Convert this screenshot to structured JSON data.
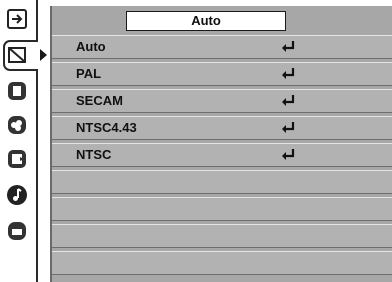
{
  "menu": {
    "current_value": "Auto",
    "items": [
      {
        "label": "Auto"
      },
      {
        "label": "PAL"
      },
      {
        "label": "SECAM"
      },
      {
        "label": "NTSC4.43"
      },
      {
        "label": "NTSC"
      },
      {
        "label": ""
      },
      {
        "label": ""
      },
      {
        "label": ""
      },
      {
        "label": ""
      }
    ]
  },
  "sidebar": {
    "icons": [
      "input-icon",
      "system-icon",
      "image-icon",
      "color-icon",
      "screen-icon",
      "sound-icon",
      "setting-icon"
    ],
    "active_index": 1
  }
}
